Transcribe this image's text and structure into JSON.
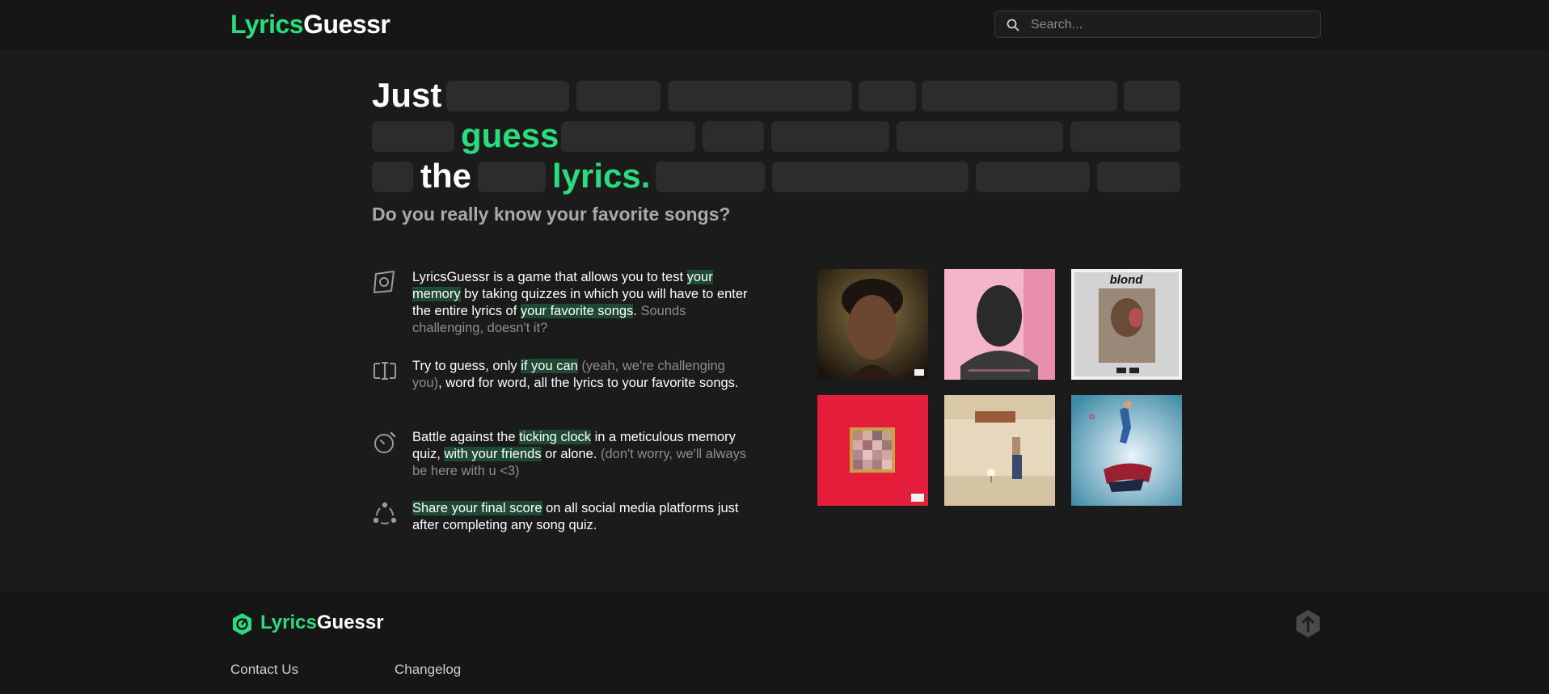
{
  "header": {
    "logo_green": "Lyrics",
    "logo_white": "Guessr",
    "search_placeholder": "Search..."
  },
  "hero": {
    "words": [
      "Just",
      "guess",
      "the",
      "lyrics."
    ],
    "subtitle": "Do you really know your favorite songs?"
  },
  "features": [
    {
      "icon": "target-icon",
      "segments": [
        {
          "text": "LyricsGuessr is a game that allows you to test ",
          "style": "normal"
        },
        {
          "text": "your memory",
          "style": "highlight"
        },
        {
          "text": " by taking quizzes in which you will have to enter the entire lyrics of ",
          "style": "normal"
        },
        {
          "text": "your favorite songs",
          "style": "highlight"
        },
        {
          "text": ". ",
          "style": "normal"
        },
        {
          "text": "Sounds challenging, doesn't it?",
          "style": "muted"
        }
      ]
    },
    {
      "icon": "text-cursor-icon",
      "segments": [
        {
          "text": "Try to guess, only ",
          "style": "normal"
        },
        {
          "text": "if you can",
          "style": "highlight"
        },
        {
          "text": " (yeah, we're challenging you)",
          "style": "muted"
        },
        {
          "text": ", word for word, all the lyrics to your favorite songs.",
          "style": "normal"
        }
      ]
    },
    {
      "icon": "stopwatch-icon",
      "segments": [
        {
          "text": "Battle against the ",
          "style": "normal"
        },
        {
          "text": "ticking clock",
          "style": "highlight"
        },
        {
          "text": " in a meticulous memory quiz, ",
          "style": "normal"
        },
        {
          "text": "with your friends",
          "style": "highlight"
        },
        {
          "text": " or alone. ",
          "style": "normal"
        },
        {
          "text": "(don't worry, we'll always be here with u <3)",
          "style": "muted"
        }
      ]
    },
    {
      "icon": "share-nodes-icon",
      "segments": [
        {
          "text": "Share your final score",
          "style": "highlight"
        },
        {
          "text": " on all social media platforms just after completing any song quiz.",
          "style": "normal"
        }
      ]
    }
  ],
  "covers": [
    {
      "name": "album-cover-1",
      "colors": [
        "#5a4a2a",
        "#2a1e14"
      ]
    },
    {
      "name": "album-cover-2",
      "colors": [
        "#f2a8c4",
        "#e88fb0"
      ]
    },
    {
      "name": "album-cover-3",
      "colors": [
        "#dcdcdc",
        "#b9b9b9"
      ],
      "label": "blond"
    },
    {
      "name": "album-cover-4",
      "colors": [
        "#e8203c",
        "#d5182f"
      ]
    },
    {
      "name": "album-cover-5",
      "colors": [
        "#e9ddc6",
        "#cdbf9f"
      ]
    },
    {
      "name": "album-cover-6",
      "colors": [
        "#cfe6f1",
        "#4e8fa8"
      ]
    }
  ],
  "footer": {
    "logo_green": "Lyrics",
    "logo_white": "Guessr",
    "links": [
      "Contact Us",
      "Changelog"
    ]
  },
  "colors": {
    "accent": "#2bdc7f",
    "background": "#1b1b1b",
    "header": "#161616",
    "highlight": "#1e4a33"
  }
}
